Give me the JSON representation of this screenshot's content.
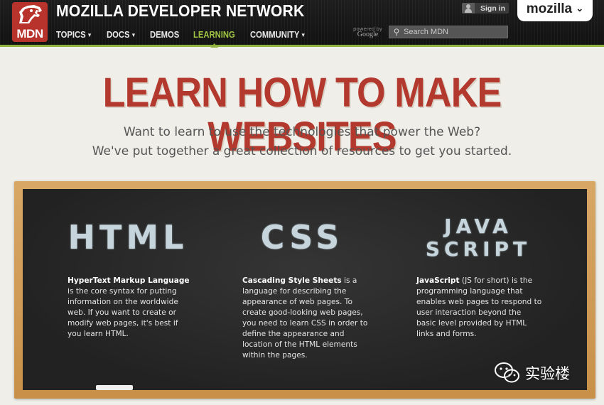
{
  "header": {
    "logo_text": "MDN",
    "site_title": "MOZILLA DEVELOPER NETWORK",
    "nav": [
      {
        "label": "TOPICS",
        "caret": true,
        "active": false
      },
      {
        "label": "DOCS",
        "caret": true,
        "active": false
      },
      {
        "label": "DEMOS",
        "caret": false,
        "active": false
      },
      {
        "label": "LEARNING",
        "caret": false,
        "active": true
      },
      {
        "label": "COMMUNITY",
        "caret": true,
        "active": false
      }
    ],
    "signin_label": "Sign in",
    "mozilla_label": "mozilla",
    "powered_by": "powered by",
    "powered_brand": "Google",
    "search_placeholder": "Search MDN"
  },
  "hero": {
    "title": "LEARN HOW TO MAKE WEBSITES",
    "subtitle_line1": "Want to learn to use the technologies that power the Web?",
    "subtitle_line2": "We've put together a great collection of resources to get you started."
  },
  "columns": [
    {
      "title_lines": [
        "HTML"
      ],
      "term": "HyperText Markup Language",
      "text": " is the core syntax for putting information on the worldwide web. If you want to create or modify web pages, it's best if you learn HTML."
    },
    {
      "title_lines": [
        "CSS"
      ],
      "term": "Cascading Style Sheets",
      "text": " is a language for describing the appearance of web pages. To create good-looking web pages, you need to learn CSS in order to define the appearance and location of the HTML elements within the pages."
    },
    {
      "title_lines": [
        "JAVA",
        "SCRIPT"
      ],
      "term": "JavaScript",
      "text": " (JS for short) is the programming language that enables web pages to respond to user interaction beyond the basic level provided by HTML links and forms."
    }
  ],
  "watermark": "实验楼",
  "colors": {
    "brand_red": "#b3382e",
    "nav_active": "#9ec342",
    "board_frame": "#c89048",
    "board": "#262626"
  }
}
